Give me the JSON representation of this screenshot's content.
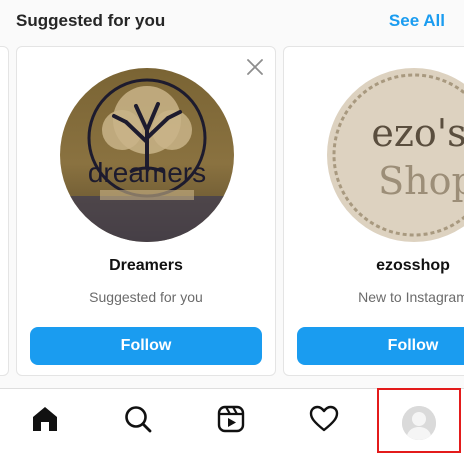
{
  "header": {
    "title": "Suggested for you",
    "see_all": "See All"
  },
  "suggestions": [
    {
      "name": "Dreamers",
      "subtitle": "Suggested for you",
      "follow_label": "Follow",
      "avatar_text": "dreamers",
      "dismissible": true
    },
    {
      "name": "ezosshop",
      "subtitle": "New to Instagram",
      "follow_label": "Follow",
      "avatar_text_line1": "ezo's",
      "avatar_text_line2": "Shop",
      "dismissible": false
    }
  ],
  "tab_bar": {
    "items": [
      "home-icon",
      "search-icon",
      "reels-icon",
      "heart-icon",
      "profile-avatar"
    ],
    "active": "home-icon",
    "highlighted": "profile-avatar",
    "highlight_color": "#e31b1b"
  },
  "colors": {
    "accent": "#1a9cf0",
    "background": "#fafafa"
  }
}
